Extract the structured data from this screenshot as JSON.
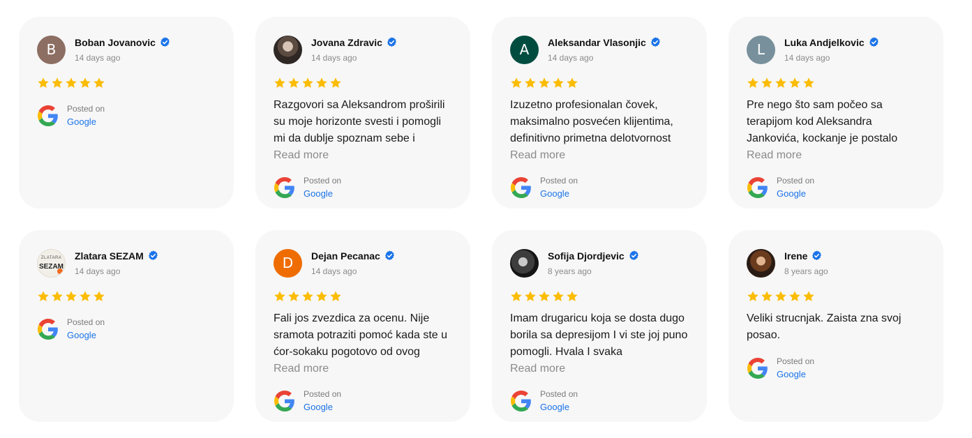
{
  "posted_label": "Posted on",
  "posted_source": "Google",
  "read_more": "Read more",
  "colors": {
    "star": "#fbbc04",
    "verified": "#1a73e8",
    "card_bg": "#f7f7f7"
  },
  "reviews": [
    {
      "name": "Boban Jovanovic",
      "date": "14 days ago",
      "avatar_letter": "B",
      "avatar_color": "#8d6e63",
      "rating": 5,
      "text": ""
    },
    {
      "name": "Jovana Zdravic",
      "date": "14 days ago",
      "avatar_letter": "",
      "avatar_color": "",
      "rating": 5,
      "text": "Razgovori sa Aleksandrom proširili su moje horizonte svesti i pomogli mi da dublje spoznam sebe i"
    },
    {
      "name": "Aleksandar Vlasonjic",
      "date": "14 days ago",
      "avatar_letter": "A",
      "avatar_color": "#004d40",
      "rating": 5,
      "text": "Izuzetno profesionalan čovek, maksimalno posvećen klijentima, definitivno primetna delotvornost"
    },
    {
      "name": "Luka Andjelkovic",
      "date": "14 days ago",
      "avatar_letter": "L",
      "avatar_color": "#78909c",
      "rating": 5,
      "text": "Pre nego što sam počeo sa terapijom kod Aleksandra Jankovića, kockanje je postalo"
    },
    {
      "name": "Zlatara SEZAM",
      "date": "14 days ago",
      "avatar_letter": "",
      "avatar_color": "",
      "logo_top": "ZLATARA",
      "logo_main": "SEZAM",
      "rating": 5,
      "text": ""
    },
    {
      "name": "Dejan Pecanac",
      "date": "14 days ago",
      "avatar_letter": "D",
      "avatar_color": "#ef6c00",
      "rating": 5,
      "text": "Fali jos zvezdica za ocenu. Nije sramota potraziti pomoć kada ste u ćor-sokaku pogotovo od ovog"
    },
    {
      "name": "Sofija Djordjevic",
      "date": "8 years ago",
      "avatar_letter": "",
      "avatar_color": "",
      "rating": 5,
      "text": "Imam drugaricu koja se dosta dugo borila sa depresijom I vi ste joj puno pomogli. Hvala I svaka"
    },
    {
      "name": "Irene",
      "date": "8 years ago",
      "avatar_letter": "",
      "avatar_color": "",
      "rating": 5,
      "text": "Veliki strucnjak. Zaista zna svoj posao."
    }
  ]
}
